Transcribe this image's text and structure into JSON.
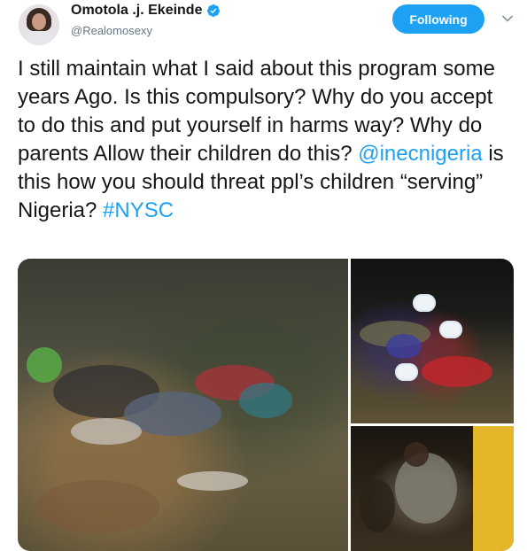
{
  "user": {
    "display_name": "Omotola .j. Ekeinde",
    "handle": "@Realomosexy",
    "verified": true
  },
  "actions": {
    "follow_label": "Following"
  },
  "tweet": {
    "text_part1": "I still maintain what I said about this program some years Ago. Is this compulsory? Why do you accept to do this and put yourself in harms way? Why do parents Allow their children do this? ",
    "mention": "@inecnigeria",
    "text_part2": " is this how you should threat ppl’s children “serving” Nigeria? ",
    "hashtag": "#NYSC"
  },
  "colors": {
    "accent": "#1da1f2",
    "text": "#14171a",
    "secondary": "#657786"
  },
  "icons": {
    "verified": "verified-badge-icon",
    "caret": "chevron-down-icon"
  }
}
